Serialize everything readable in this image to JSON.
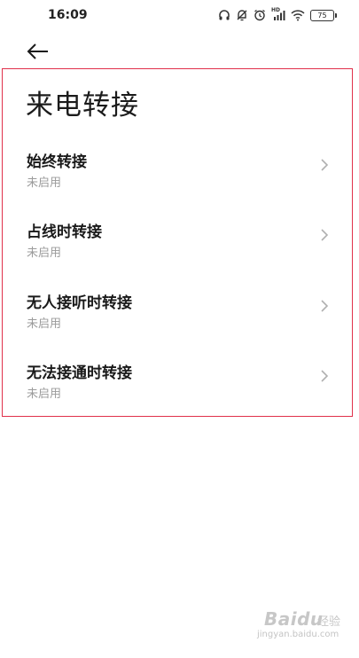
{
  "status_bar": {
    "time": "16:09",
    "icons": [
      "headphones-icon",
      "mute-icon",
      "alarm-icon",
      "signal-icon",
      "wifi-icon",
      "battery-icon"
    ],
    "network_label": "HD",
    "battery_level": "75"
  },
  "header": {
    "back_icon": "back-arrow-icon",
    "title": "来电转接"
  },
  "settings": {
    "items": [
      {
        "title": "始终转接",
        "status": "未启用"
      },
      {
        "title": "占线时转接",
        "status": "未启用"
      },
      {
        "title": "无人接听时转接",
        "status": "未启用"
      },
      {
        "title": "无法接通时转接",
        "status": "未启用"
      }
    ]
  },
  "watermark": {
    "brand": "Baidu",
    "suffix": "经验",
    "url": "jingyan.baidu.com"
  },
  "colors": {
    "highlight_border": "#e0304a",
    "subtitle_gray": "#9b9b9b",
    "chevron_gray": "#b0b0b0"
  }
}
